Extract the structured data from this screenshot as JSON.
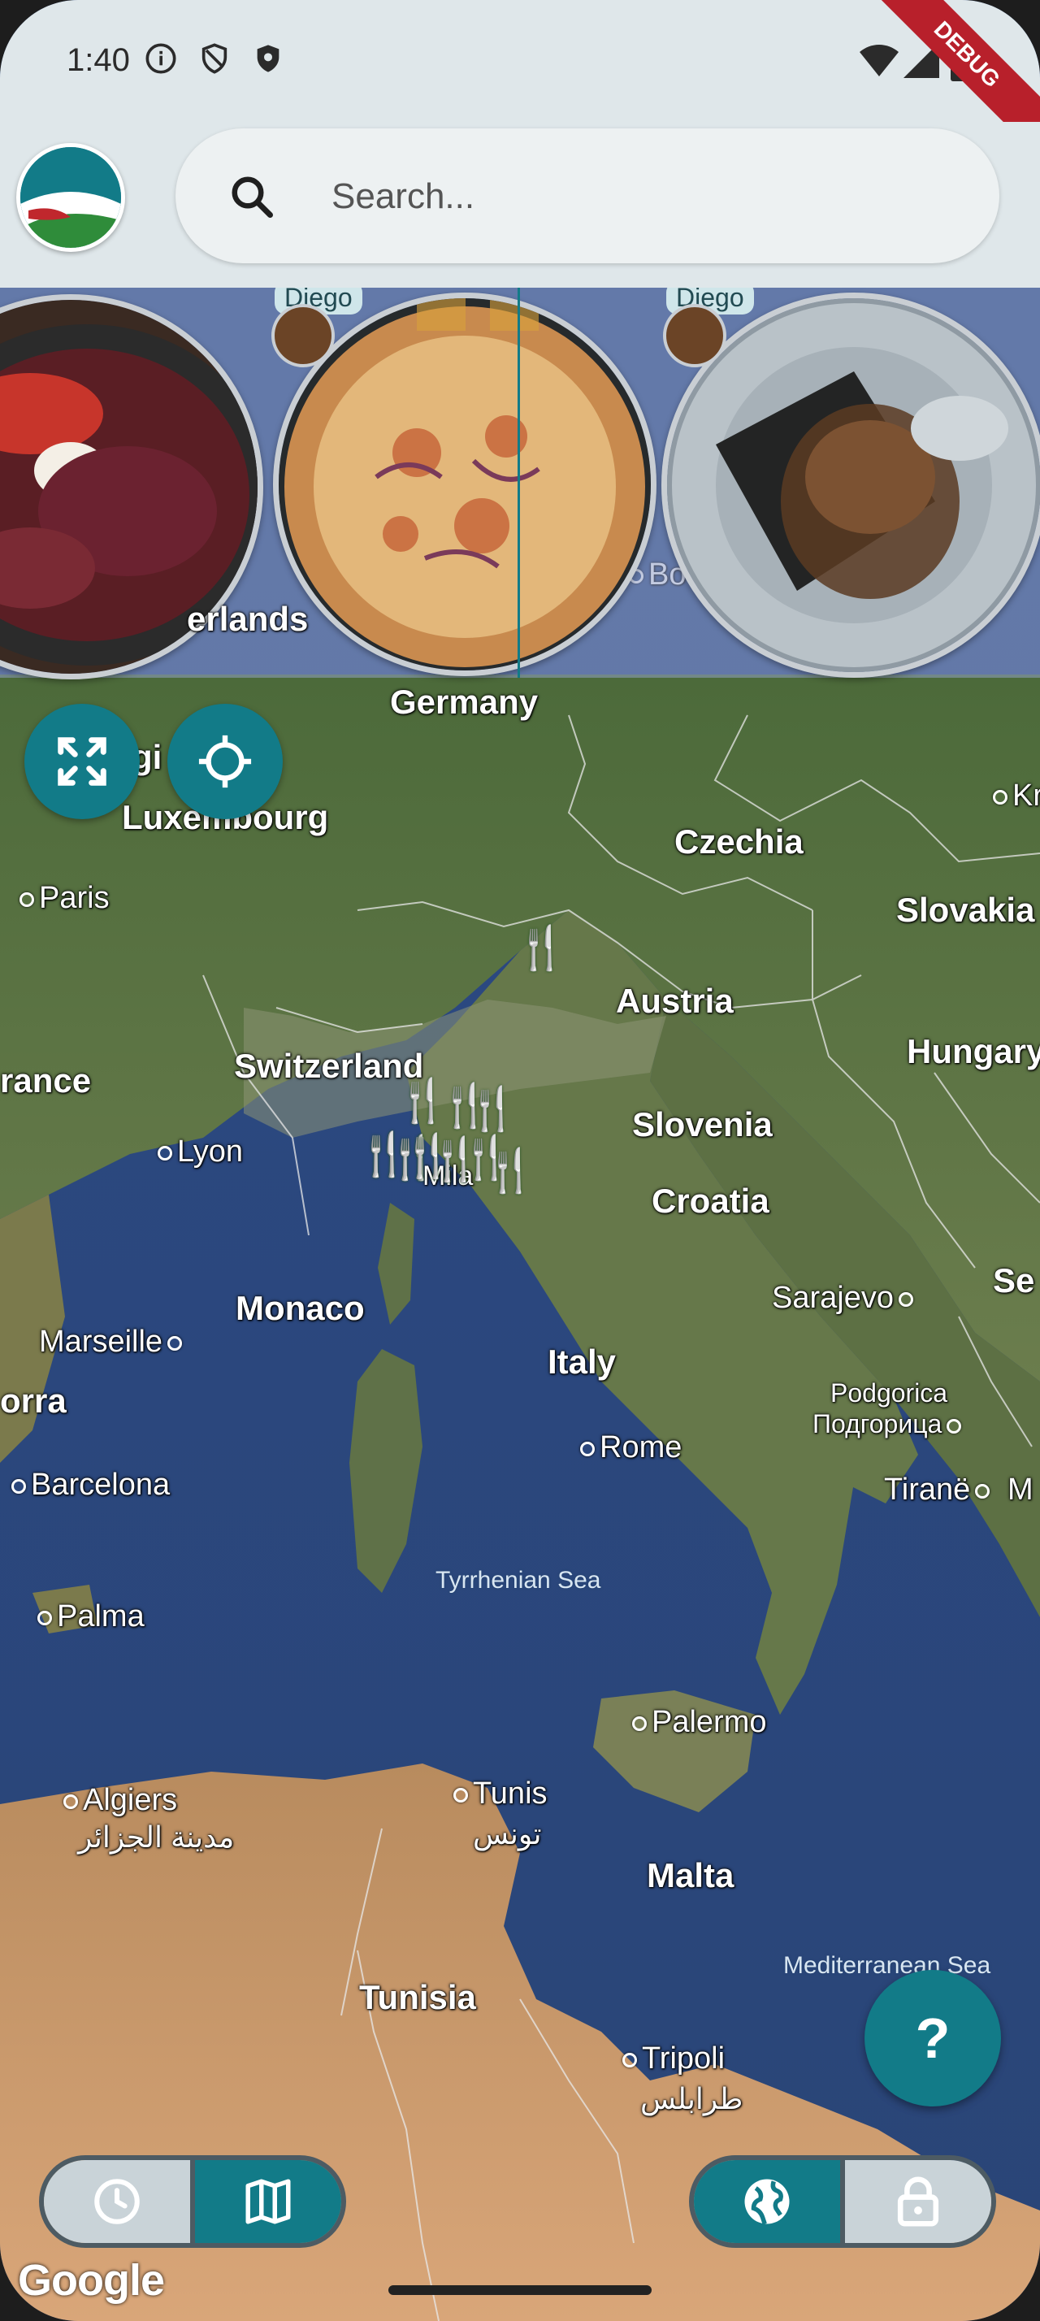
{
  "status_bar": {
    "time": "1:40",
    "debug_banner": "DEBUG"
  },
  "search": {
    "placeholder": "Search..."
  },
  "photo_strip": {
    "items": [
      {
        "dish": "sliced cured meat with tomatoes and mozzarella",
        "user": ""
      },
      {
        "dish": "pizza with red onions",
        "user": "Diego"
      },
      {
        "dish": "tiramisu in a glass",
        "user": "Diego"
      }
    ],
    "partial_label": "erlands"
  },
  "map": {
    "countries": [
      {
        "name": "Germany"
      },
      {
        "name": "Luxembourg"
      },
      {
        "name": "Czechia"
      },
      {
        "name": "Slovakia"
      },
      {
        "name": "Austria"
      },
      {
        "name": "Switzerland"
      },
      {
        "name": "Hungary"
      },
      {
        "name": "rance"
      },
      {
        "name": "Slovenia"
      },
      {
        "name": "Croatia"
      },
      {
        "name": "Monaco"
      },
      {
        "name": "Italy"
      },
      {
        "name": "Malta"
      },
      {
        "name": "Tunisia"
      },
      {
        "name": "orra"
      },
      {
        "name": "Se"
      },
      {
        "name": "gi"
      }
    ],
    "cities": [
      {
        "name": "Paris"
      },
      {
        "name": "Lyon"
      },
      {
        "name": "Marseille"
      },
      {
        "name": "Barcelona"
      },
      {
        "name": "Palma"
      },
      {
        "name": "Rome"
      },
      {
        "name": "Sarajevo"
      },
      {
        "name": "Podgorica"
      },
      {
        "name": "Подгорица"
      },
      {
        "name": "Tiranë"
      },
      {
        "name": "Palermo"
      },
      {
        "name": "Algiers"
      },
      {
        "name": "مدينة الجزائر"
      },
      {
        "name": "Tunis"
      },
      {
        "name": "تونس"
      },
      {
        "name": "Tripoli"
      },
      {
        "name": "طرابلس"
      },
      {
        "name": "Kr"
      },
      {
        "name": "M"
      },
      {
        "name": "Bo"
      },
      {
        "name": "Mila"
      }
    ],
    "seas": [
      {
        "name": "Tyrrhenian Sea"
      },
      {
        "name": "Mediterranean Sea"
      }
    ],
    "attribution": "Google"
  },
  "buttons": {
    "help_label": "?",
    "fullscreen_icon": "fullscreen-icon",
    "locate_icon": "crosshair-icon",
    "left_toggle": [
      "clock-icon",
      "map-icon"
    ],
    "right_toggle": [
      "globe-icon",
      "lock-icon"
    ]
  },
  "colors": {
    "accent": "#127b88",
    "pin_green": "#49b54a",
    "pin_red": "#e8503c",
    "debug": "#b8202b"
  }
}
